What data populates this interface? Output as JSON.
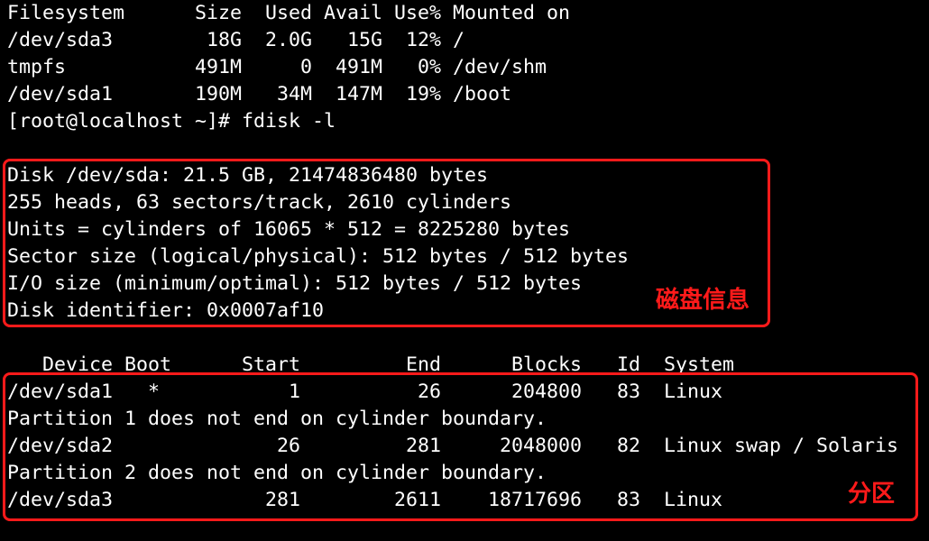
{
  "terminal": {
    "lines": [
      "Filesystem      Size  Used Avail Use% Mounted on",
      "/dev/sda3        18G  2.0G   15G  12% /",
      "tmpfs           491M     0  491M   0% /dev/shm",
      "/dev/sda1       190M   34M  147M  19% /boot",
      "[root@localhost ~]# fdisk -l",
      "",
      "Disk /dev/sda: 21.5 GB, 21474836480 bytes",
      "255 heads, 63 sectors/track, 2610 cylinders",
      "Units = cylinders of 16065 * 512 = 8225280 bytes",
      "Sector size (logical/physical): 512 bytes / 512 bytes",
      "I/O size (minimum/optimal): 512 bytes / 512 bytes",
      "Disk identifier: 0x0007af10",
      "",
      "   Device Boot      Start         End      Blocks   Id  System",
      "/dev/sda1   *           1          26      204800   83  Linux",
      "Partition 1 does not end on cylinder boundary.",
      "/dev/sda2              26         281     2048000   82  Linux swap / Solaris",
      "Partition 2 does not end on cylinder boundary.",
      "/dev/sda3             281        2611    18717696   83  Linux"
    ]
  },
  "annotations": {
    "disk_info_label": "磁盘信息",
    "partition_label": "分区"
  },
  "colors": {
    "background": "#000000",
    "text": "#ffffff",
    "highlight": "#ff1a1a"
  }
}
